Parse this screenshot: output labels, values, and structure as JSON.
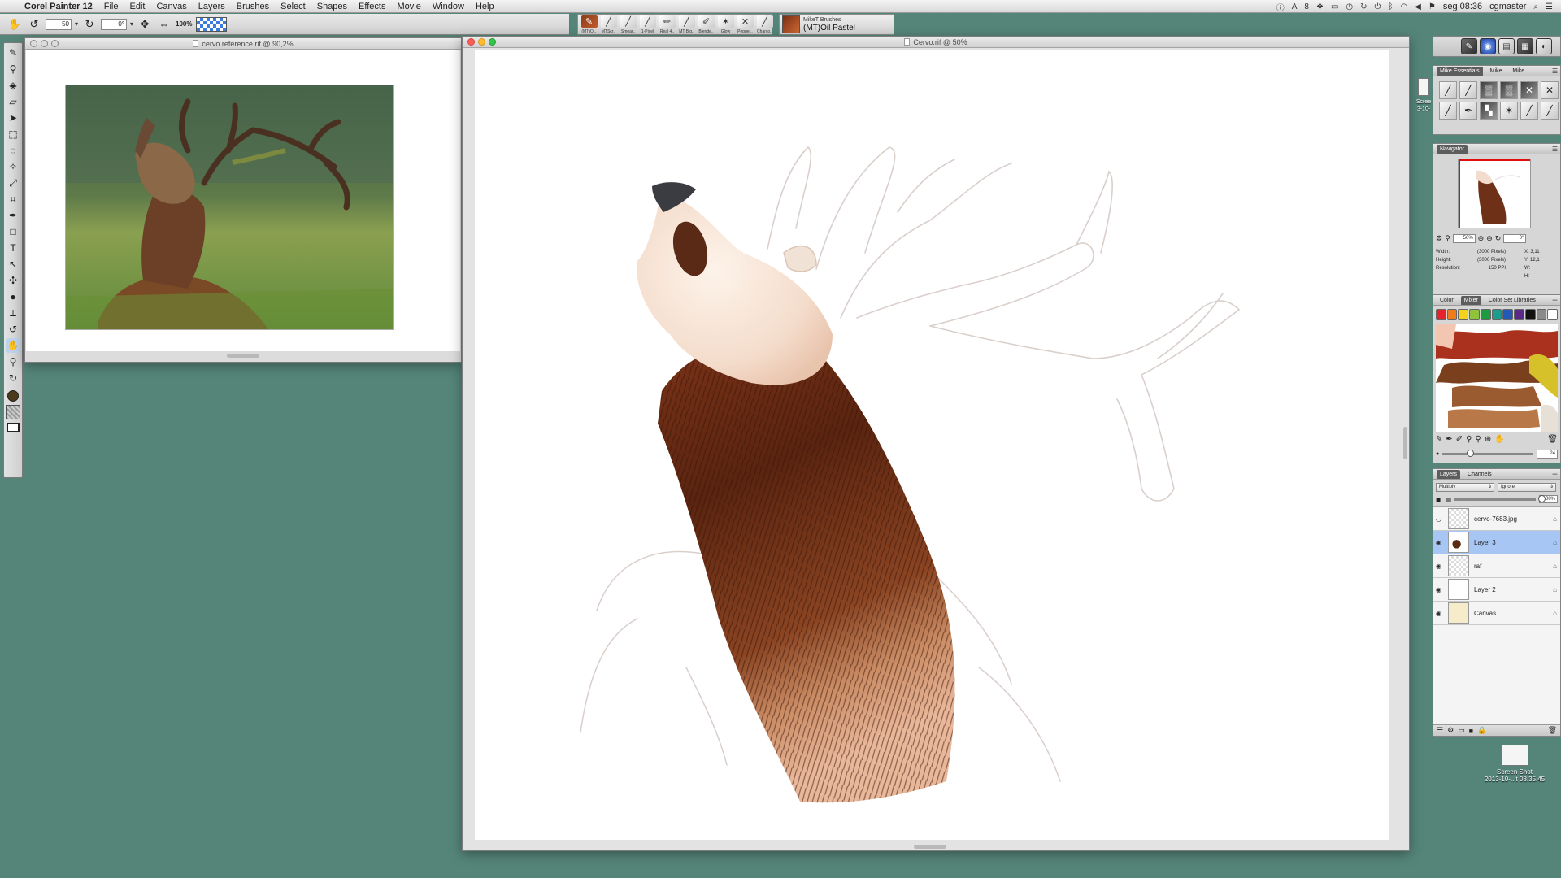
{
  "menubar": {
    "app_name": "Corel Painter 12",
    "items": [
      "File",
      "Edit",
      "Canvas",
      "Layers",
      "Brushes",
      "Select",
      "Shapes",
      "Effects",
      "Movie",
      "Window",
      "Help"
    ],
    "status_battery_digit": "8",
    "clock": "seg 08:36",
    "user": "cgmaster"
  },
  "propbar": {
    "size_value": "50",
    "angle_value": "0°",
    "zoom_value": "100%"
  },
  "brush_strip": {
    "items": [
      {
        "label": "(MT)Oi..",
        "icon": "oil-brush"
      },
      {
        "label": "MTScr..",
        "icon": "scratch-brush"
      },
      {
        "label": "Smear..",
        "icon": "smear-brush"
      },
      {
        "label": "1-Pixel",
        "icon": "pixel-brush"
      },
      {
        "label": "Real 4..",
        "icon": "real-brush"
      },
      {
        "label": "MT Big..",
        "icon": "big-brush"
      },
      {
        "label": "Blende..",
        "icon": "blender-brush"
      },
      {
        "label": "Glow",
        "icon": "glow-brush"
      },
      {
        "label": "Pepper..",
        "icon": "pepper-brush"
      },
      {
        "label": "Charco..",
        "icon": "charcoal-brush"
      }
    ]
  },
  "brush_selector": {
    "category": "MikeT Brushes",
    "variant": "(MT)Oil Pastel"
  },
  "ref_window": {
    "title": "cervo reference.rif @ 90,2%"
  },
  "main_window": {
    "title": "Cervo.rif @ 50%"
  },
  "palettes": {
    "brush_library": {
      "tabs": [
        "Mike Essentials",
        "Mike",
        "Mike"
      ]
    },
    "navigator": {
      "title": "Navigator",
      "zoom": "50%",
      "angle": "0°",
      "info": [
        {
          "label": "Width:",
          "value": "(3000 Pixels)"
        },
        {
          "label": "Height:",
          "value": "(3000 Pixels)"
        },
        {
          "label": "Resolution:",
          "value": "150 PPI"
        }
      ],
      "x_label": "X:",
      "x_value": "3,11",
      "y_label": "Y:",
      "y_value": "12,1",
      "w_label": "W:",
      "h_label": "H:"
    },
    "mixer": {
      "tabs": [
        "Color",
        "Mixer",
        "Color Set Libraries"
      ],
      "slider_value": "24",
      "slider_fraction": 0.3,
      "swatch_colors": [
        "#e8222a",
        "#f07d1a",
        "#f5d31c",
        "#8fc43a",
        "#1c9b3f",
        "#1c9b8e",
        "#2559b8",
        "#5a2a8a",
        "#111111",
        "#8a8a8a",
        "#ffffff"
      ]
    },
    "layers": {
      "tabs": [
        "Layers",
        "Channels"
      ],
      "composite_method": "Multiply",
      "composite_depth": "Ignore",
      "opacity": "100%",
      "opacity_fraction": 1.0,
      "rows": [
        {
          "name": "cervo-7683.jpg",
          "thumb": "checker",
          "visible": false,
          "selected": false
        },
        {
          "name": "Layer 3",
          "thumb": "deer",
          "visible": true,
          "selected": true
        },
        {
          "name": "raf",
          "thumb": "checker",
          "visible": true,
          "selected": false
        },
        {
          "name": "Layer 2",
          "thumb": "plain",
          "visible": true,
          "selected": false
        },
        {
          "name": "Canvas",
          "thumb": "canvas",
          "visible": true,
          "selected": false
        }
      ]
    }
  },
  "desktop": {
    "file_top_label": "Scree\n3-10-",
    "file_bottom_label": "Screen Shot\n2013-10-...t 08.35.45"
  }
}
